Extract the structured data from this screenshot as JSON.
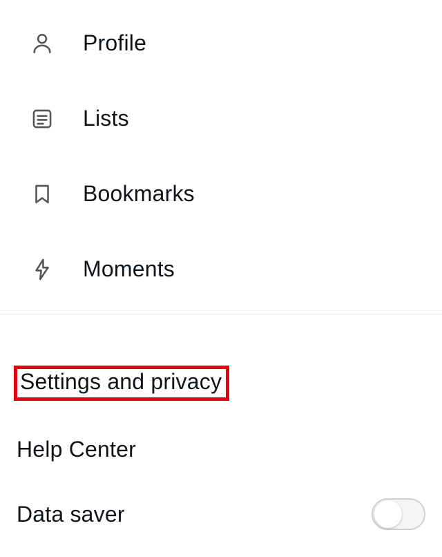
{
  "menu": {
    "profile": "Profile",
    "lists": "Lists",
    "bookmarks": "Bookmarks",
    "moments": "Moments"
  },
  "settings": {
    "settings_and_privacy": "Settings and privacy",
    "help_center": "Help Center",
    "data_saver": "Data saver",
    "data_saver_on": false
  }
}
